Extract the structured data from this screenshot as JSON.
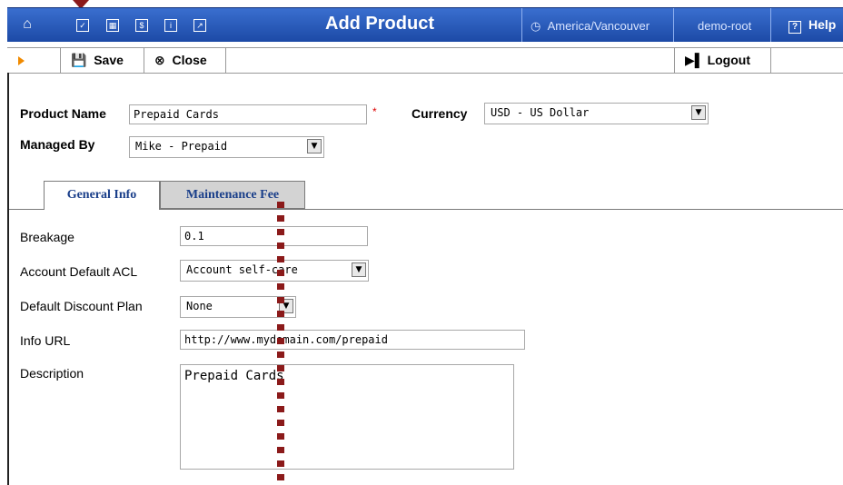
{
  "header": {
    "title": "Add Product",
    "timezone": "America/Vancouver",
    "user": "demo-root",
    "help_label": "Help",
    "icons": [
      "home-icon",
      "checklist-icon",
      "grid-icon",
      "dollar-icon",
      "info-icon",
      "chart-icon"
    ]
  },
  "toolbar": {
    "save_label": "Save",
    "close_label": "Close",
    "logout_label": "Logout"
  },
  "form": {
    "product_name_label": "Product Name",
    "product_name_value": "Prepaid Cards",
    "currency_label": "Currency",
    "currency_value": "USD - US Dollar",
    "managed_by_label": "Managed By",
    "managed_by_value": "Mike - Prepaid"
  },
  "tabs": [
    {
      "label": "General Info",
      "active": true
    },
    {
      "label": "Maintenance Fee",
      "active": false
    }
  ],
  "general": {
    "breakage_label": "Breakage",
    "breakage_value": "0.1",
    "acl_label": "Account Default ACL",
    "acl_value": "Account self-care",
    "discount_label": "Default Discount Plan",
    "discount_value": "None",
    "info_url_label": "Info URL",
    "info_url_value": "http://www.mydomain.com/prepaid",
    "description_label": "Description",
    "description_value": "Prepaid Cards"
  },
  "colors": {
    "header_bg": "#2a5bbd",
    "tab_text": "#1a3f8a",
    "annotation": "#8b1a1a"
  }
}
